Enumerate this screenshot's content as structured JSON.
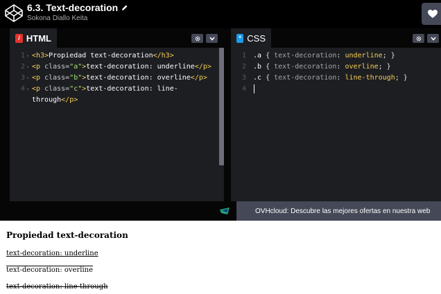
{
  "header": {
    "title": "6.3. Text-decoration",
    "author": "Sokona Diallo Keita"
  },
  "html_pane": {
    "tab_label": "HTML",
    "tab_badge": "/",
    "lines": [
      {
        "n": "1",
        "parts": [
          [
            "tag",
            "<h3>"
          ],
          [
            "txtw",
            "Propiedad text-decoration"
          ],
          [
            "tag",
            "</h3>"
          ]
        ]
      },
      {
        "n": "2",
        "parts": [
          [
            "tag",
            "<p "
          ],
          [
            "attr",
            "class="
          ],
          [
            "str",
            "\"a\""
          ],
          [
            "tag",
            ">"
          ],
          [
            "txtw",
            "text-decoration: underline"
          ],
          [
            "tag",
            "</p>"
          ]
        ]
      },
      {
        "n": "3",
        "parts": [
          [
            "tag",
            "<p "
          ],
          [
            "attr",
            "class="
          ],
          [
            "str",
            "\"b\""
          ],
          [
            "tag",
            ">"
          ],
          [
            "txtw",
            "text-decoration: overline"
          ],
          [
            "tag",
            "</p>"
          ]
        ]
      },
      {
        "n": "4",
        "parts": [
          [
            "tag",
            "<p "
          ],
          [
            "attr",
            "class="
          ],
          [
            "str",
            "\"c\""
          ],
          [
            "tag",
            ">"
          ],
          [
            "txtw",
            "text-decoration: line-"
          ]
        ]
      },
      {
        "n": "",
        "parts": [
          [
            "txtw",
            "through"
          ],
          [
            "tag",
            "</p>"
          ]
        ]
      }
    ]
  },
  "css_pane": {
    "tab_label": "CSS",
    "tab_badge": "*",
    "lines": [
      {
        "n": "1",
        "parts": [
          [
            "sel",
            ".a "
          ],
          [
            "punc",
            "{ "
          ],
          [
            "prop",
            "text-decoration"
          ],
          [
            "punc",
            ": "
          ],
          [
            "val",
            "underline"
          ],
          [
            "punc",
            "; }"
          ]
        ]
      },
      {
        "n": "2",
        "parts": [
          [
            "sel",
            ".b "
          ],
          [
            "punc",
            "{ "
          ],
          [
            "prop",
            "text-decoration"
          ],
          [
            "punc",
            ": "
          ],
          [
            "val",
            "overline"
          ],
          [
            "punc",
            "; }"
          ]
        ]
      },
      {
        "n": "3",
        "parts": [
          [
            "sel",
            ".c "
          ],
          [
            "punc",
            "{ "
          ],
          [
            "prop",
            "text-decoration"
          ],
          [
            "punc",
            ": "
          ],
          [
            "val",
            "line-through"
          ],
          [
            "punc",
            "; }"
          ]
        ]
      },
      {
        "n": "4",
        "parts": []
      }
    ]
  },
  "ad": {
    "text": "OVHcloud: Descubre las mejores ofertas en nuestra web"
  },
  "result": {
    "heading": "Propiedad text-decoration",
    "p_a": "text-decoration: underline",
    "p_b": "text-decoration: overline",
    "p_c": "text-decoration: line-through"
  },
  "colors": {
    "header_bg": "#000000",
    "pane_bg": "#1d1e22",
    "html_badge": "#e4322c",
    "css_badge": "#1b9be9",
    "ad_bg": "#444857"
  }
}
